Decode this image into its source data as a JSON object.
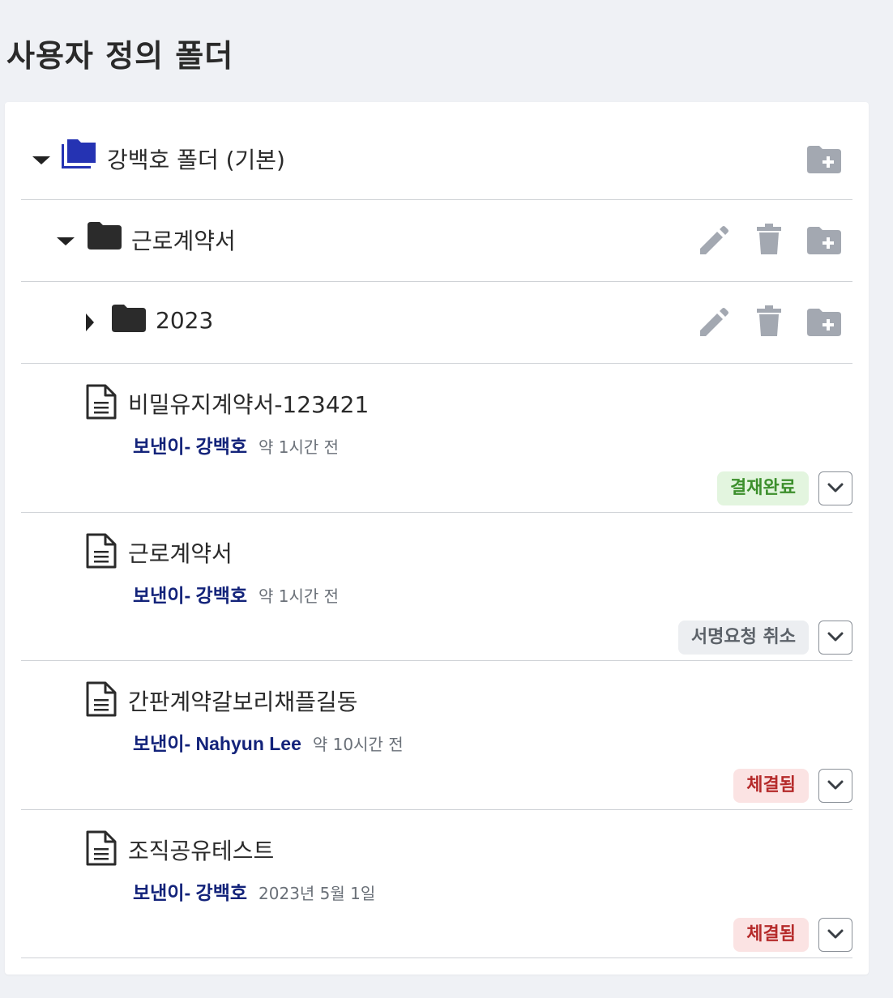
{
  "page": {
    "title": "사용자 정의 폴더"
  },
  "folders": {
    "root": {
      "label": "강백호 폴더 (기본)"
    },
    "sub1": {
      "label": "근로계약서"
    },
    "sub2": {
      "label": "2023"
    }
  },
  "documents": [
    {
      "title": "비밀유지계약서-123421",
      "sender": "보낸이- 강백호",
      "time": "약 1시간 전",
      "status": "결재완료",
      "status_bg": "#e3f5df",
      "status_fg": "#3c8f2c"
    },
    {
      "title": "근로계약서",
      "sender": "보낸이- 강백호",
      "time": "약 1시간 전",
      "status": "서명요청 취소",
      "status_bg": "#eceef1",
      "status_fg": "#5b6168"
    },
    {
      "title": "간판계약갈보리채플길동",
      "sender": "보낸이- Nahyun Lee",
      "time": "약 10시간 전",
      "status": "체결됨",
      "status_bg": "#fbe3e3",
      "status_fg": "#b52a2a"
    },
    {
      "title": "조직공유테스트",
      "sender": "보낸이- 강백호",
      "time": "2023년 5월 1일",
      "status": "체결됨",
      "status_bg": "#fbe3e3",
      "status_fg": "#b52a2a"
    }
  ],
  "colors": {
    "root_folder_icon": "#2533b3",
    "folder_icon": "#2b2b2b",
    "action_icon": "#a3a8b1",
    "sender_text": "#13237a"
  },
  "icons": {
    "root_folder": "folder-multiple-icon",
    "folder": "folder-icon",
    "document": "document-icon",
    "edit": "pencil-icon",
    "delete": "trash-icon",
    "add_folder": "folder-plus-icon",
    "expand": "chevron-down-icon"
  }
}
